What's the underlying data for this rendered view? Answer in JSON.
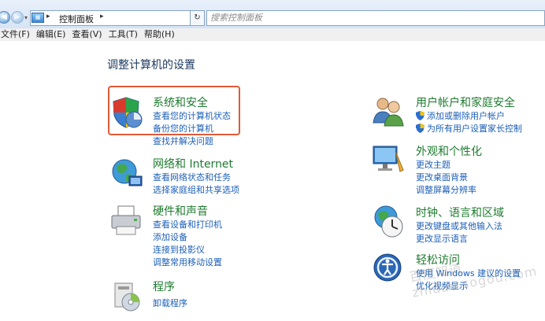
{
  "address": {
    "crumb": "控制面板",
    "search_placeholder": "搜索控制面板",
    "refresh_glyph": "↻"
  },
  "menu": [
    "文件(F)",
    "编辑(E)",
    "查看(V)",
    "工具(T)",
    "帮助(H)"
  ],
  "heading": "调整计算机的设置",
  "categories": [
    {
      "title": "系统和安全",
      "links": [
        "查看您的计算机状态",
        "备份您的计算机",
        "查找并解决问题"
      ],
      "icon": "shield-icon"
    },
    {
      "title": "网络和 Internet",
      "links": [
        "查看网络状态和任务",
        "选择家庭组和共享选项"
      ],
      "icon": "network-globe-icon"
    },
    {
      "title": "硬件和声音",
      "links": [
        "查看设备和打印机",
        "添加设备",
        "连接到投影仪",
        "调整常用移动设置"
      ],
      "icon": "printer-icon"
    },
    {
      "title": "程序",
      "links": [
        "卸载程序"
      ],
      "icon": "programs-icon"
    },
    {
      "title": "用户帐户和家庭安全",
      "links": [
        "添加或删除用户帐户",
        "为所有用户设置家长控制"
      ],
      "icon": "users-icon"
    },
    {
      "title": "外观和个性化",
      "links": [
        "更改主题",
        "更改桌面背景",
        "调整屏幕分辨率"
      ],
      "icon": "appearance-icon"
    },
    {
      "title": "时钟、语言和区域",
      "links": [
        "更改键盘或其他输入法",
        "更改显示语言"
      ],
      "icon": "clock-globe-icon"
    },
    {
      "title": "轻松访问",
      "links": [
        "使用 Windows 建议的设置",
        "优化视频显示"
      ],
      "icon": "ease-of-access-icon"
    }
  ],
  "colors": {
    "accent_title": "#1e7a2f",
    "link": "#1c5fb7",
    "highlight": "#e05a37"
  },
  "watermark": "百度知道 zhidao.sogou.com"
}
